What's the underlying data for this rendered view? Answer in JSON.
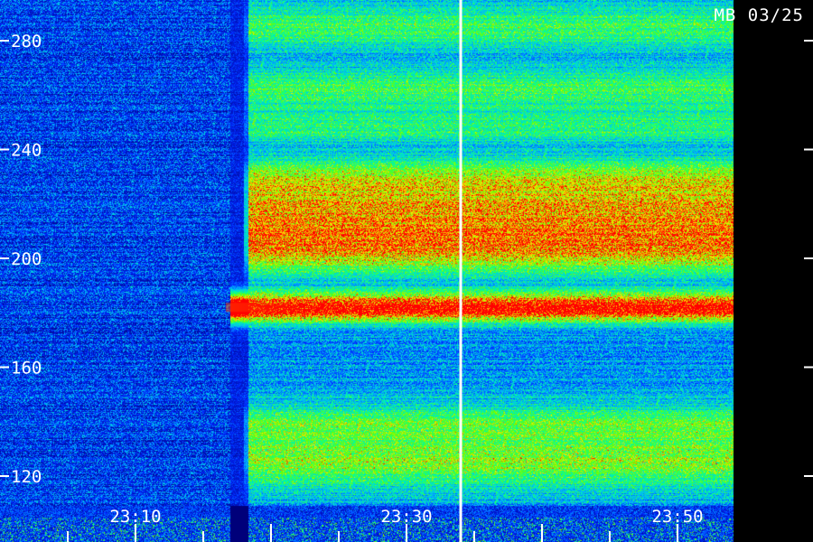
{
  "header": {
    "label": "MB 03/25"
  },
  "chart_data": {
    "type": "heatmap",
    "title": "MB 03/25",
    "y_ticks": [
      "280",
      "240",
      "200",
      "160",
      "120"
    ],
    "y_tick_values": [
      280,
      240,
      200,
      160,
      120
    ],
    "ylim": [
      107,
      294
    ],
    "x_ticks": [
      "23:10",
      "23:30",
      "23:50"
    ],
    "x_tick_values_min": [
      10,
      30,
      50
    ],
    "xlim_min": [
      0,
      54
    ],
    "signal_start_min": 17,
    "gap_min": [
      17,
      18.3
    ],
    "cursor_min": 34,
    "data_end_min": 54,
    "bands": [
      {
        "center": 182,
        "width": 5,
        "intensity": 0.95,
        "start_min": 16.8
      },
      {
        "center": 204,
        "width": 9,
        "intensity": 0.62,
        "start_min": 18
      },
      {
        "center": 218,
        "width": 10,
        "intensity": 0.55,
        "start_min": 18
      },
      {
        "center": 230,
        "width": 7,
        "intensity": 0.38,
        "start_min": 18
      },
      {
        "center": 262,
        "width": 8,
        "intensity": 0.3,
        "start_min": 18
      },
      {
        "center": 126,
        "width": 10,
        "intensity": 0.42,
        "start_min": 18
      },
      {
        "center": 140,
        "width": 7,
        "intensity": 0.3,
        "start_min": 18
      },
      {
        "center": 248,
        "width": 6,
        "intensity": 0.25,
        "start_min": 18
      },
      {
        "center": 285,
        "width": 8,
        "intensity": 0.3,
        "start_min": 18
      }
    ],
    "grid": false,
    "colormap": [
      "#00007a",
      "#0028ff",
      "#00b4ff",
      "#00ffa0",
      "#64ff00",
      "#ffe600",
      "#ff0000"
    ],
    "tick_color": "#ffffff",
    "cursor_color": "#ffffff"
  }
}
